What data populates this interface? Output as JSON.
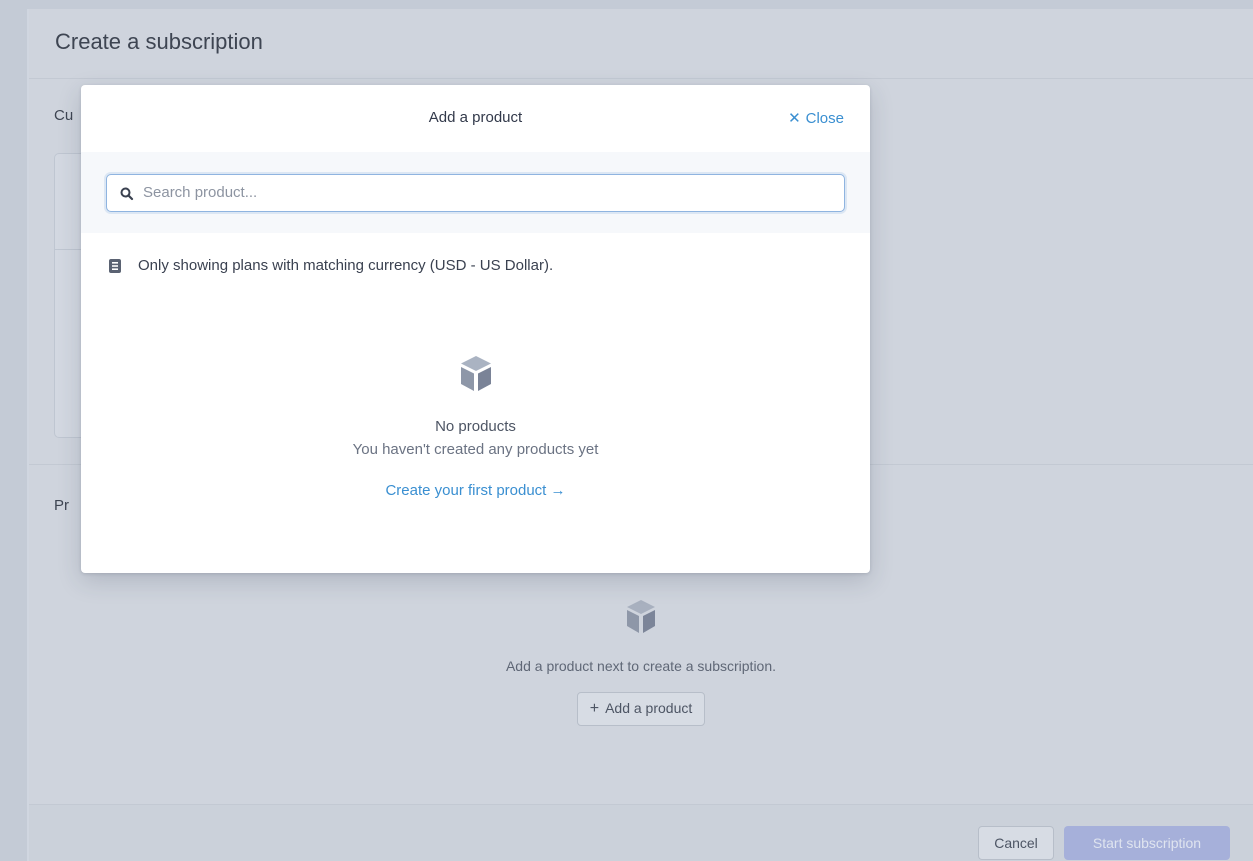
{
  "page": {
    "title": "Create a subscription",
    "sections": {
      "customer_label": "Cu",
      "products_label": "Pr"
    },
    "products_empty": {
      "icon": "box-icon",
      "message": "Add a product next to create a subscription.",
      "add_button": "Add a product",
      "add_button_icon": "plus-icon"
    },
    "footer": {
      "cancel": "Cancel",
      "start": "Start subscription"
    }
  },
  "modal": {
    "title": "Add a product",
    "close": "Close",
    "close_icon": "close-icon",
    "search": {
      "placeholder": "Search product...",
      "value": "",
      "icon": "search-icon"
    },
    "info": {
      "icon": "info-icon",
      "text": "Only showing plans with matching currency (USD - US Dollar)."
    },
    "empty": {
      "icon": "box-icon",
      "title": "No products",
      "subtitle": "You haven't created any products yet",
      "link": "Create your first product →"
    }
  },
  "colors": {
    "link": "#3a8fd1",
    "overlay_bg": "#d0d6e0",
    "primary_disabled": "#a6b0da",
    "search_focus": "#8fb4e0"
  }
}
